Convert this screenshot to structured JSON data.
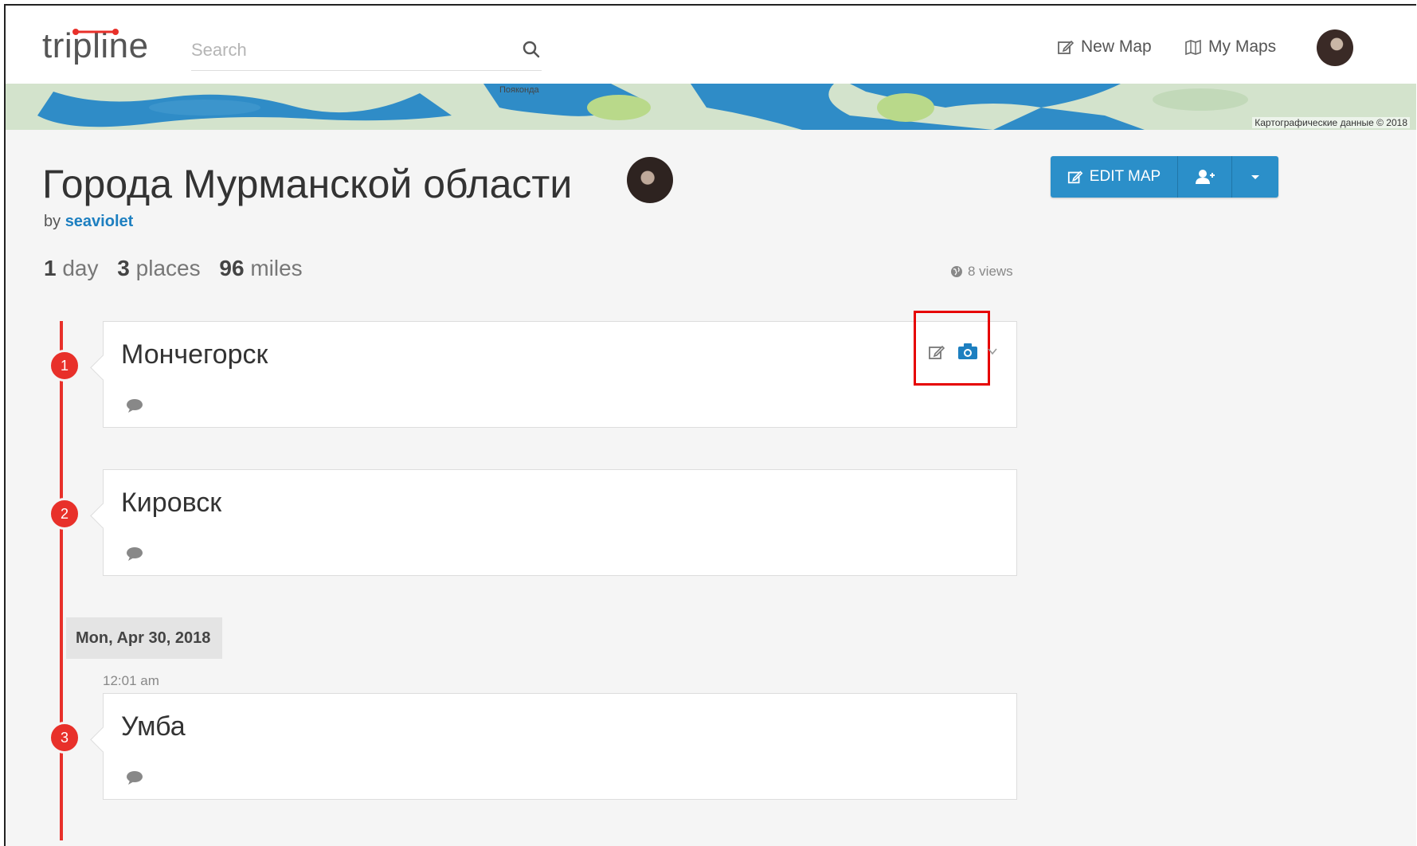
{
  "header": {
    "logo_text": "tripline",
    "search_placeholder": "Search",
    "nav": [
      {
        "label": "New Map",
        "icon": "edit-icon"
      },
      {
        "label": "My Maps",
        "icon": "map-icon"
      }
    ]
  },
  "map": {
    "label_1": "Пояконда",
    "credit": "Картографические данные © 2018"
  },
  "trip": {
    "title": "Города Мурманской области",
    "by_label": "by",
    "author": "seaviolet",
    "stats": {
      "days_value": "1",
      "days_label": "day",
      "places_value": "3",
      "places_label": "places",
      "miles_value": "96",
      "miles_label": "miles"
    },
    "views": "8 views"
  },
  "actions": {
    "edit_map": "EDIT MAP"
  },
  "places": [
    {
      "number": "1",
      "name": "Мончегорск"
    },
    {
      "number": "2",
      "name": "Кировск"
    },
    {
      "number": "3",
      "name": "Умба"
    }
  ],
  "date_divider": "Mon, Apr 30, 2018",
  "place3_time": "12:01 am",
  "colors": {
    "accent": "#2b8fc9",
    "timeline": "#e8302a",
    "highlight": "#e60000"
  }
}
